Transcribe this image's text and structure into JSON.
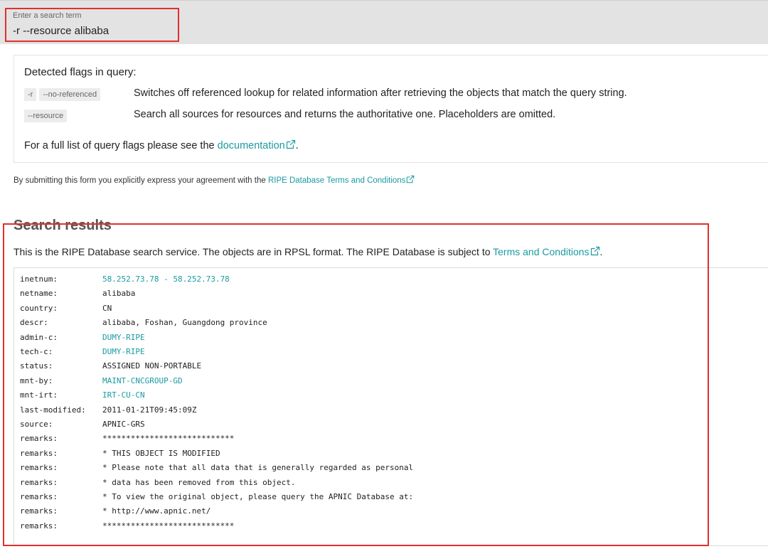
{
  "search": {
    "label": "Enter a search term",
    "value": "-r --resource alibaba"
  },
  "flags": {
    "title": "Detected flags in query:",
    "rows": [
      {
        "chips": [
          "-r",
          "--no-referenced"
        ],
        "desc": "Switches off referenced lookup for related information after retrieving the objects that match the query string."
      },
      {
        "chips": [
          "--resource"
        ],
        "desc": "Search all sources for resources and returns the authoritative one. Placeholders are omitted."
      }
    ],
    "doc_prefix": "For a full list of query flags please see the ",
    "doc_link": "documentation",
    "doc_suffix": "."
  },
  "terms": {
    "prefix": "By submitting this form you explicitly express your agreement with the ",
    "link": "RIPE Database Terms and Conditions"
  },
  "results": {
    "heading": "Search results",
    "intro_prefix": "This is the RIPE Database search service. The objects are in RPSL format. The RIPE Database is subject to ",
    "intro_link": "Terms and Conditions",
    "intro_suffix": "."
  },
  "rpsl": [
    {
      "key": "inetnum:",
      "value": "58.252.73.78 - 58.252.73.78",
      "link": true
    },
    {
      "key": "netname:",
      "value": "alibaba",
      "link": false
    },
    {
      "key": "country:",
      "value": "CN",
      "link": false
    },
    {
      "key": "descr:",
      "value": "alibaba, Foshan, Guangdong province",
      "link": false
    },
    {
      "key": "admin-c:",
      "value": "DUMY-RIPE",
      "link": true
    },
    {
      "key": "tech-c:",
      "value": "DUMY-RIPE",
      "link": true
    },
    {
      "key": "status:",
      "value": "ASSIGNED NON-PORTABLE",
      "link": false
    },
    {
      "key": "mnt-by:",
      "value": "MAINT-CNCGROUP-GD",
      "link": true
    },
    {
      "key": "mnt-irt:",
      "value": "IRT-CU-CN",
      "link": true
    },
    {
      "key": "last-modified:",
      "value": "2011-01-21T09:45:09Z",
      "link": false
    },
    {
      "key": "source:",
      "value": "APNIC-GRS",
      "link": false
    },
    {
      "key": "remarks:",
      "value": "****************************",
      "link": false
    },
    {
      "key": "remarks:",
      "value": "* THIS OBJECT IS MODIFIED",
      "link": false
    },
    {
      "key": "remarks:",
      "value": "* Please note that all data that is generally regarded as personal",
      "link": false
    },
    {
      "key": "remarks:",
      "value": "* data has been removed from this object.",
      "link": false
    },
    {
      "key": "remarks:",
      "value": "* To view the original object, please query the APNIC Database at:",
      "link": false
    },
    {
      "key": "remarks:",
      "value": "* http://www.apnic.net/",
      "link": false
    },
    {
      "key": "remarks:",
      "value": "****************************",
      "link": false
    }
  ],
  "colors": {
    "link": "#1a9aa0",
    "highlight": "#e0302f",
    "searchbar_bg": "#e3e3e3"
  },
  "icons": {
    "external_link": "external-link-icon"
  }
}
